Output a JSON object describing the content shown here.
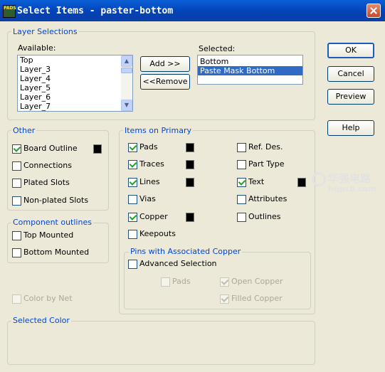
{
  "window": {
    "title": "Select Items - paster-bottom",
    "app_icon_text": "PADS"
  },
  "layer_selections": {
    "legend": "Layer Selections",
    "available_label": "Available:",
    "available_items": [
      "Top",
      "Layer_3",
      "Layer_4",
      "Layer_5",
      "Layer_6",
      "Layer_7"
    ],
    "selected_label": "Selected:",
    "selected_items": [
      "Bottom",
      "Paste Mask Bottom"
    ],
    "add_button": "Add >>",
    "remove_button": "<<Remove"
  },
  "buttons": {
    "ok": "OK",
    "cancel": "Cancel",
    "preview": "Preview",
    "help": "Help"
  },
  "other": {
    "legend": "Other",
    "board_outline": "Board Outline",
    "connections": "Connections",
    "plated_slots": "Plated Slots",
    "non_plated_slots": "Non-plated Slots"
  },
  "component_outlines": {
    "legend": "Component outlines",
    "top_mounted": "Top Mounted",
    "bottom_mounted": "Bottom Mounted"
  },
  "color_by_net": "Color by Net",
  "items_on_primary": {
    "legend": "Items on Primary",
    "pads": "Pads",
    "traces": "Traces",
    "lines": "Lines",
    "vias": "Vias",
    "copper": "Copper",
    "keepouts": "Keepouts",
    "ref_des": "Ref. Des.",
    "part_type": "Part Type",
    "text": "Text",
    "attributes": "Attributes",
    "outlines": "Outlines"
  },
  "pins_assoc": {
    "legend": "Pins with Associated Copper",
    "advanced_selection": "Advanced Selection",
    "pads": "Pads",
    "open_copper": "Open Copper",
    "filled_copper": "Filled Copper"
  },
  "selected_color": {
    "legend": "Selected Color"
  },
  "watermark": {
    "cn": "华强电路",
    "url": "hqpcb.com"
  },
  "colors": {
    "swatch": "#000000",
    "accent": "#0046d5",
    "selection": "#316ac5"
  }
}
